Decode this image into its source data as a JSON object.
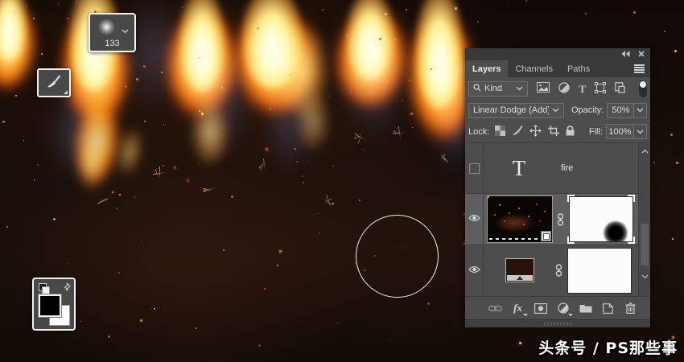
{
  "overlays": {
    "brush_preview": {
      "size": "133"
    },
    "watermark": "头条号 / PS那些事"
  },
  "panel": {
    "tabs": {
      "layers": "Layers",
      "channels": "Channels",
      "paths": "Paths"
    },
    "filter": {
      "kind": "Kind",
      "type_glyph": "T"
    },
    "blend": {
      "mode": "Linear Dodge (Add)",
      "opacity_label": "Opacity:",
      "opacity": "50%"
    },
    "lock": {
      "label": "Lock:",
      "fill_label": "Fill:",
      "fill": "100%"
    },
    "layers": {
      "text_layer": {
        "name": "fire",
        "thumb_glyph": "T",
        "visible": false,
        "selected": false
      },
      "smart_layer": {
        "visible": true,
        "selected": true,
        "has_mask": true
      },
      "adjustment_layer": {
        "visible": true,
        "selected": false,
        "has_mask": true
      }
    },
    "footer": {
      "fx": "fx"
    }
  },
  "colors": {
    "panel_bg": "#4d4d4d",
    "panel_header": "#393939",
    "selected_row": "#5e5e5e",
    "flame_orange": "#ffa02e",
    "flame_yellow": "#ffd35e",
    "spark": "#ff8a3c"
  }
}
